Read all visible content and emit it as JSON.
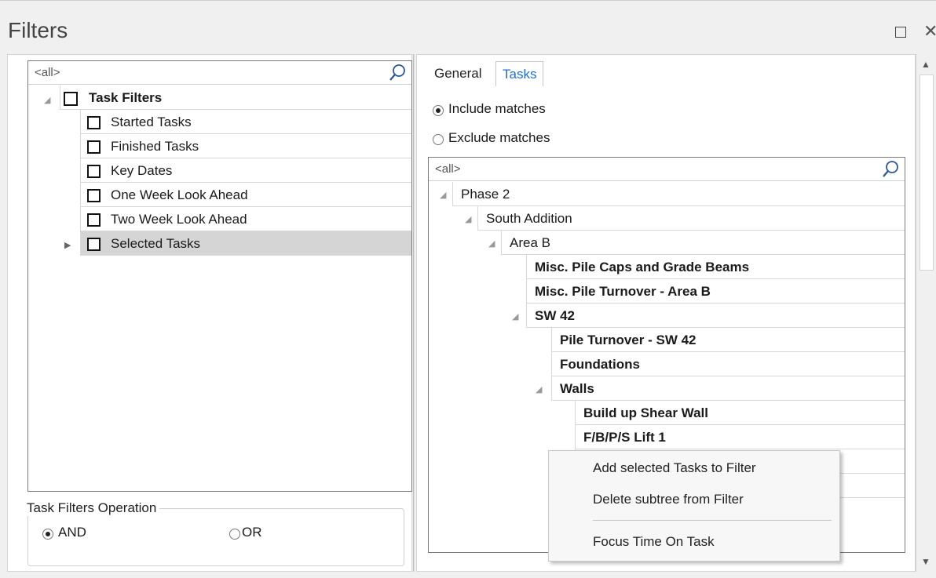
{
  "window": {
    "title": "Filters",
    "maximize_glyph": "",
    "close_glyph": "✕"
  },
  "left": {
    "search_value": "<all>",
    "tree": {
      "root": {
        "label": "Task Filters"
      },
      "items": [
        {
          "label": "Started Tasks"
        },
        {
          "label": "Finished Tasks"
        },
        {
          "label": "Key Dates"
        },
        {
          "label": "One Week Look Ahead"
        },
        {
          "label": "Two Week Look Ahead"
        },
        {
          "label": "Selected Tasks"
        }
      ]
    },
    "operation": {
      "title": "Task Filters Operation",
      "and_label": "AND",
      "or_label": "OR",
      "selected": "AND"
    }
  },
  "right": {
    "tabs": [
      {
        "label": "General"
      },
      {
        "label": "Tasks"
      }
    ],
    "active_tab": "Tasks",
    "include_label": "Include matches",
    "exclude_label": "Exclude matches",
    "match_mode": "Include matches",
    "search_value": "<all>",
    "tree": [
      {
        "label": "Phase 2"
      },
      {
        "label": "South Addition"
      },
      {
        "label": "Area B"
      },
      {
        "label": "Misc. Pile Caps and Grade Beams"
      },
      {
        "label": "Misc. Pile Turnover - Area B"
      },
      {
        "label": "SW 42"
      },
      {
        "label": "Pile Turnover - SW 42"
      },
      {
        "label": "Foundations"
      },
      {
        "label": "Walls"
      },
      {
        "label": "Build up Shear Wall"
      },
      {
        "label": "F/B/P/S Lift 1"
      }
    ]
  },
  "context_menu": {
    "items": [
      {
        "label": "Add selected Tasks to Filter"
      },
      {
        "label": "Delete subtree from Filter"
      },
      {
        "label": "Focus Time On Task"
      }
    ]
  },
  "colors": {
    "accent": "#1e6fd1",
    "selected_row": "#d5d5d5"
  }
}
